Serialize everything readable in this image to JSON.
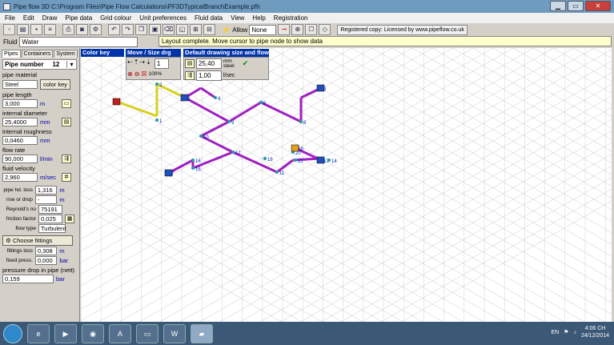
{
  "window": {
    "title": "Pipe flow 3D C:\\Program Files\\Pipe Flow Calculations\\PF3DTypicalBranchExample.pfh"
  },
  "menu": [
    "File",
    "Edit",
    "Draw",
    "Pipe data",
    "Grid colour",
    "Unit preferences",
    "Fluid data",
    "View",
    "Help",
    "Registration"
  ],
  "toolbar": {
    "allow_label": "Allow",
    "allow_value": "None",
    "registered": "Registered copy: Licensed by www.pipeflow.co.uk"
  },
  "fluid": {
    "label": "Fluid",
    "value": "Water"
  },
  "status": "Layout complete. Move cursor to pipe node to show data",
  "tabs": [
    "Pipes",
    "Containers",
    "System"
  ],
  "pipe": {
    "number_label": "Pipe number",
    "number": "12",
    "material_label": "pipe material",
    "material": "Steel",
    "color_key_btn": "color key",
    "length_label": "pipe length",
    "length": "3,000",
    "length_unit": "m",
    "diam_label": "internal diameter",
    "diam": "25,4000",
    "diam_unit": "mm",
    "rough_label": "internal roughness",
    "rough": "0,0460",
    "rough_unit": "mm",
    "flow_label": "flow rate",
    "flow": "90,000",
    "flow_unit": "l/min",
    "vel_label": "fluid velocity",
    "vel": "2,960",
    "vel_unit": "m/sec",
    "hdloss_label": "pipe hd. loss",
    "hdloss": "1,316",
    "hdloss_unit": "m",
    "rise_label": "rise or drop",
    "rise": "-",
    "rise_unit": "m",
    "re_label": "Reynold's no",
    "re": "75191",
    "ff_label": "friction factor",
    "ff": "0,025",
    "ft_label": "flow type",
    "ft": "Turbulent",
    "fittings_btn": "Choose fittings",
    "floss_label": "fittings loss",
    "floss": "0,308",
    "floss_unit": "m",
    "fpress_label": "fixed press.",
    "fpress": "0,000",
    "fpress_unit": "bar",
    "pdrop_label": "pressure drop in pipe (nett)",
    "pdrop": "0,159",
    "pdrop_unit": "bar"
  },
  "panels": {
    "colorkey": "Color key",
    "movesize": "Move / Size drg",
    "zoom_pct": "100%",
    "zoom_sel": "1",
    "defaults": "Default drawing size and flow",
    "def_diam": "25,40",
    "def_diam_unit": "mm",
    "def_mat": "steel",
    "def_flow": "1,00",
    "def_flow_unit": "l/sec"
  },
  "nodes": [
    "1",
    "2",
    "3",
    "4",
    "5",
    "6",
    "7",
    "8",
    "9",
    "10",
    "11",
    "12",
    "13",
    "14",
    "15",
    "16",
    "17",
    "18",
    "19",
    "20"
  ],
  "tray": {
    "lang": "EN",
    "time": "4:06 CH",
    "date": "24/12/2014"
  },
  "colors": {
    "pipe": "#a020c0",
    "selected": "#d8d020",
    "node": "#20a0a0",
    "grid": "#c8c8c8"
  }
}
